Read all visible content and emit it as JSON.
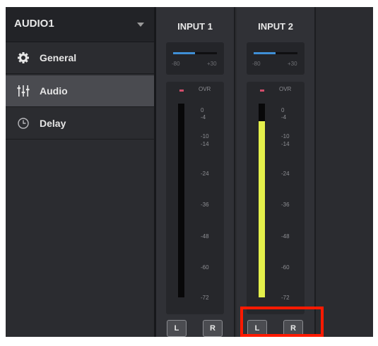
{
  "source_select": {
    "value": "AUDIO1"
  },
  "sidebar": {
    "items": [
      {
        "label": "General",
        "icon": "gear-icon",
        "active": false
      },
      {
        "label": "Audio",
        "icon": "mixer-sliders-icon",
        "active": true
      },
      {
        "label": "Delay",
        "icon": "clock-icon",
        "active": false
      }
    ]
  },
  "channels": [
    {
      "title": "INPUT 1",
      "gain": {
        "min_label": "-80",
        "max_label": "+30",
        "level": 0.5
      },
      "ovr_label": "OVR",
      "meter_level": 0.0,
      "scale": [
        "0",
        "-4",
        "-10",
        "-14",
        "-24",
        "-36",
        "-48",
        "-60",
        "-72"
      ],
      "left_label": "L",
      "right_label": "R"
    },
    {
      "title": "INPUT 2",
      "gain": {
        "min_label": "-80",
        "max_label": "+30",
        "level": 0.5
      },
      "ovr_label": "OVR",
      "meter_level": 0.91,
      "scale": [
        "0",
        "-4",
        "-10",
        "-14",
        "-24",
        "-36",
        "-48",
        "-60",
        "-72"
      ],
      "left_label": "L",
      "right_label": "R"
    }
  ],
  "colors": {
    "accent": "#3f8fd6",
    "meter_level": "#e4f04b",
    "ovr_led": "#d24d6a",
    "highlight": "#ff1a00"
  }
}
